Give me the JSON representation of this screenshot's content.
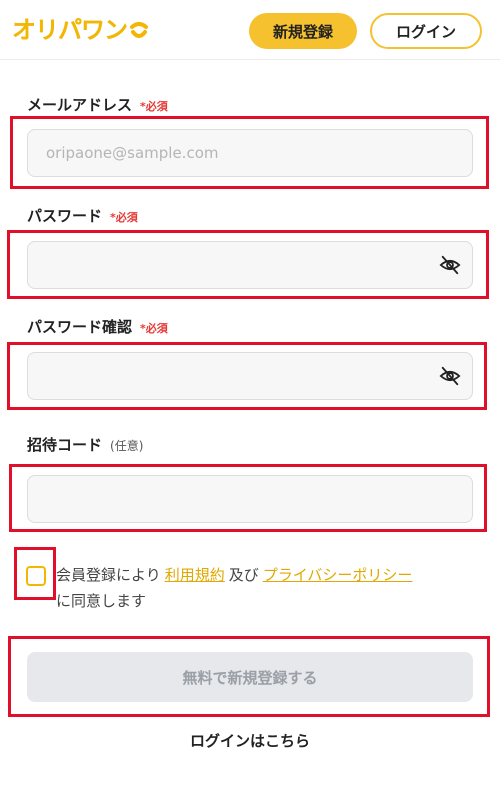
{
  "header": {
    "logo_text": "オリパワン",
    "register_label": "新規登録",
    "login_label": "ログイン"
  },
  "form": {
    "email": {
      "label": "メールアドレス",
      "required": "*必須",
      "placeholder": "oripaone@sample.com",
      "value": ""
    },
    "password": {
      "label": "パスワード",
      "required": "*必須",
      "value": ""
    },
    "password_confirm": {
      "label": "パスワード確認",
      "required": "*必須",
      "value": ""
    },
    "invite_code": {
      "label": "招待コード",
      "optional": "(任意)",
      "value": ""
    }
  },
  "agreement": {
    "prefix": "会員登録により",
    "terms_link": "利用規約",
    "connector": "及び",
    "privacy_link": "プライバシーポリシー",
    "suffix": "に同意します"
  },
  "submit_label": "無料で新規登録する",
  "login_link": "ログインはこちら",
  "colors": {
    "brand_yellow": "#f5c12e",
    "link_yellow": "#e0a800",
    "required_red": "#e53935",
    "highlight_red": "#e0102a",
    "disabled_bg": "#e6e8ec"
  },
  "icons": {
    "password_toggle": "eye-off-icon",
    "logo_mark": "smile-mark-icon"
  }
}
